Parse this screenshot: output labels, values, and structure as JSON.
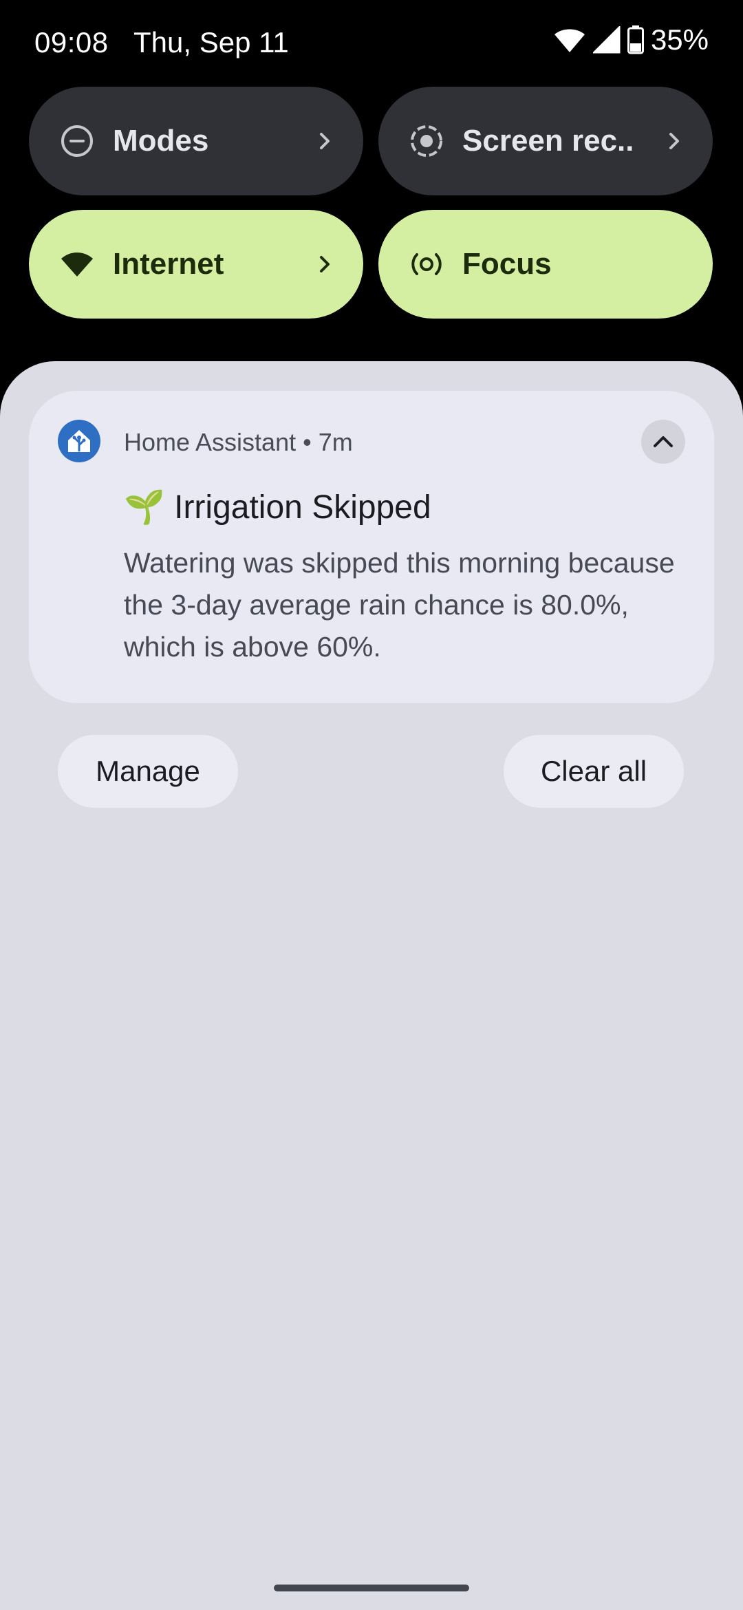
{
  "status_bar": {
    "time": "09:08",
    "date": "Thu, Sep 11",
    "battery": "35%",
    "icons": [
      "wifi-icon",
      "cell-signal-icon",
      "battery-icon"
    ]
  },
  "quick_settings": {
    "tiles": [
      {
        "label": "Modes",
        "icon": "modes-icon",
        "active": false,
        "has_chevron": true
      },
      {
        "label": "Screen rec..",
        "icon": "screen-record-icon",
        "active": false,
        "has_chevron": true
      },
      {
        "label": "Internet",
        "icon": "wifi-icon",
        "active": true,
        "has_chevron": true
      },
      {
        "label": "Focus",
        "icon": "focus-icon",
        "active": true,
        "has_chevron": false
      }
    ]
  },
  "notification": {
    "app_name": "Home Assistant",
    "header": "Home Assistant • 7m",
    "title": "🌱 Irrigation Skipped",
    "body": "Watering was skipped this morning because the 3-day average rain chance is 80.0%, which is above 60%.",
    "icon": "home-assistant-icon"
  },
  "actions": {
    "manage_label": "Manage",
    "clear_all_label": "Clear all"
  },
  "colors": {
    "tile_dark": "#2f3137",
    "tile_active": "#d4eea2",
    "shade_bg": "#dcdce4",
    "card_bg": "#e8e9f2",
    "app_icon": "#2e6fc4"
  }
}
